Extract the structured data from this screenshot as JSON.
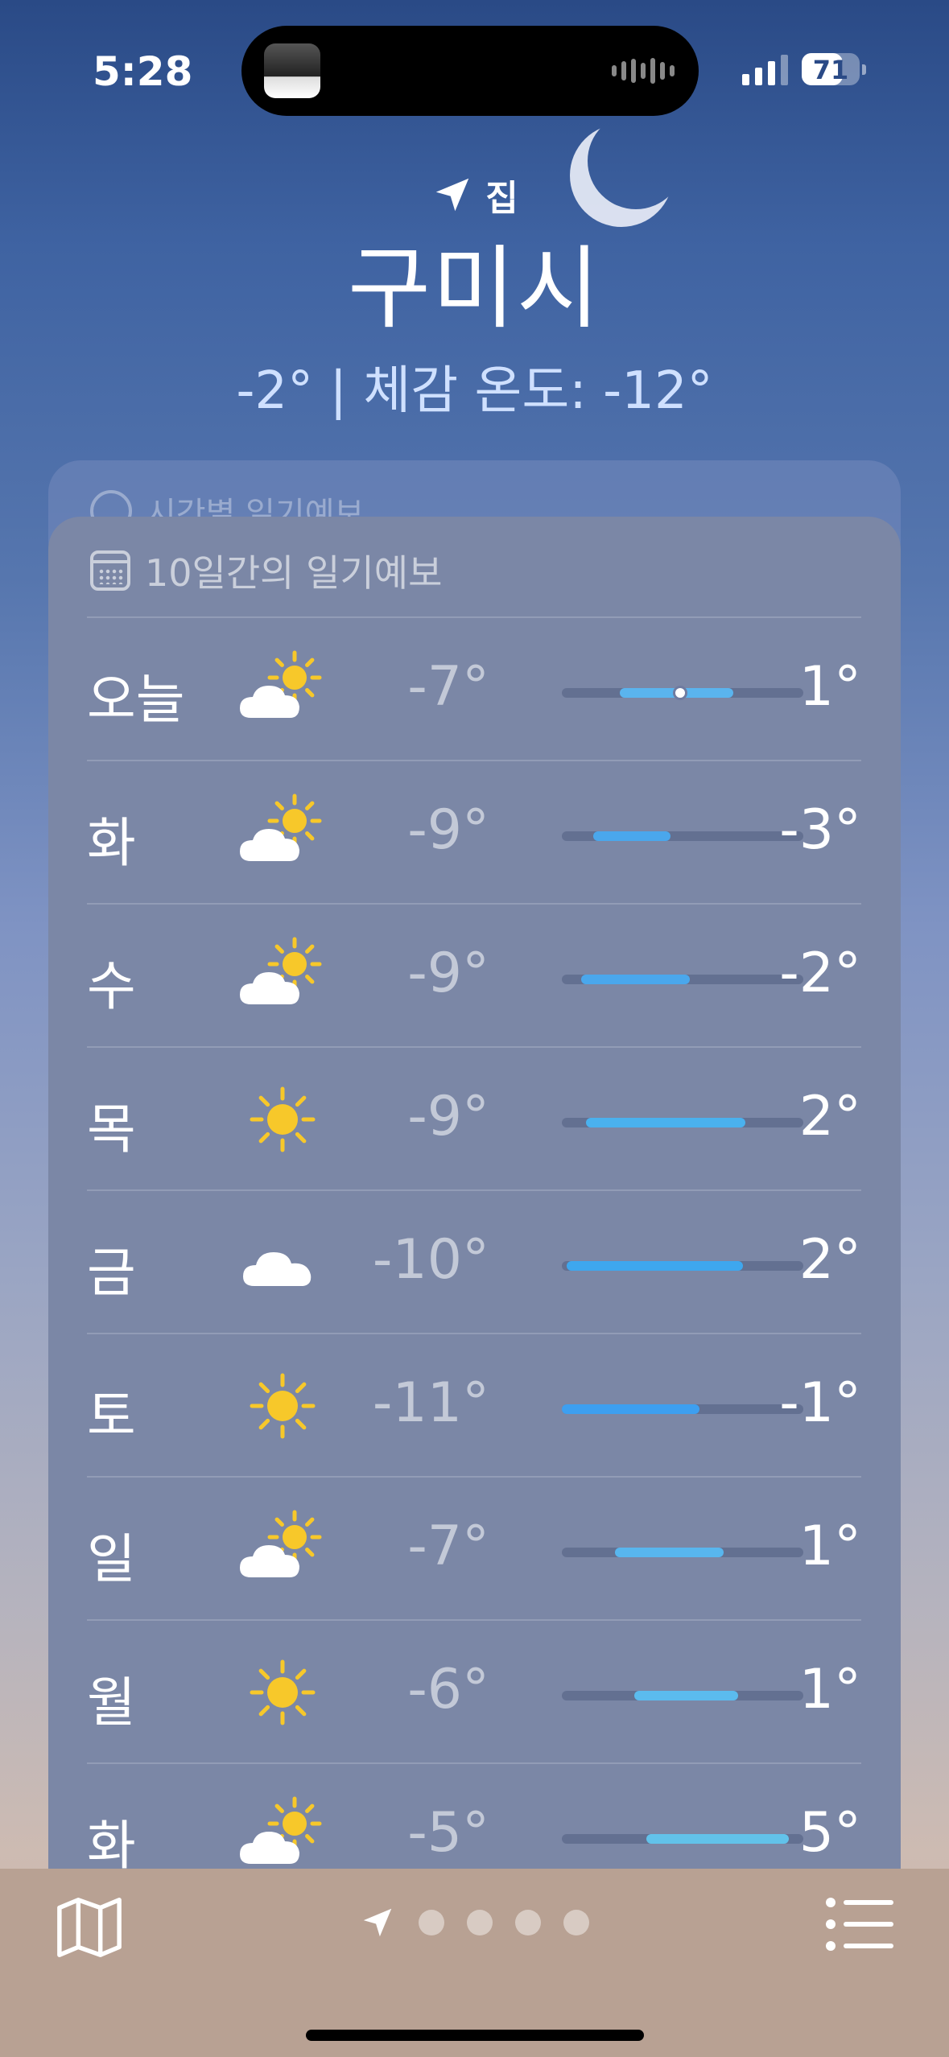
{
  "status": {
    "time": "5:28",
    "battery": "71",
    "battery_level": 0.71
  },
  "header": {
    "location_label": "집",
    "city": "구미시",
    "current": "-2° | 체감 온도: -12°"
  },
  "hourly_card": {
    "title": "시간별 일기예보"
  },
  "forecast": {
    "title": "10일간의 일기예보",
    "days": [
      {
        "day": "오늘",
        "icon": "partly-sunny-icon",
        "low": "-7°",
        "high": "1°",
        "bar_start": 0.24,
        "bar_end": 0.71,
        "current": 0.49,
        "color": "#5ab4ee"
      },
      {
        "day": "화",
        "icon": "partly-sunny-icon",
        "low": "-9°",
        "high": "-3°",
        "bar_start": 0.13,
        "bar_end": 0.45,
        "color": "#4aa7ec"
      },
      {
        "day": "수",
        "icon": "partly-sunny-icon",
        "low": "-9°",
        "high": "-2°",
        "bar_start": 0.08,
        "bar_end": 0.53,
        "color": "#4aa7ec"
      },
      {
        "day": "목",
        "icon": "sun-icon",
        "low": "-9°",
        "high": "2°",
        "bar_start": 0.1,
        "bar_end": 0.76,
        "color": "#4ab1ee"
      },
      {
        "day": "금",
        "icon": "cloud-icon",
        "low": "-10°",
        "high": "2°",
        "bar_start": 0.02,
        "bar_end": 0.75,
        "color": "#3ea7ee"
      },
      {
        "day": "토",
        "icon": "sun-icon",
        "low": "-11°",
        "high": "-1°",
        "bar_start": 0.0,
        "bar_end": 0.57,
        "color": "#3d9ff0"
      },
      {
        "day": "일",
        "icon": "partly-sunny-icon",
        "low": "-7°",
        "high": "1°",
        "bar_start": 0.22,
        "bar_end": 0.67,
        "color": "#58b6ee"
      },
      {
        "day": "월",
        "icon": "sun-icon",
        "low": "-6°",
        "high": "1°",
        "bar_start": 0.3,
        "bar_end": 0.73,
        "color": "#5bbbee"
      },
      {
        "day": "화",
        "icon": "partly-sunny-icon",
        "low": "-5°",
        "high": "5°",
        "bar_start": 0.35,
        "bar_end": 0.94,
        "color": "#62c2ea"
      }
    ]
  },
  "bottom": {
    "page_dots": 4
  }
}
